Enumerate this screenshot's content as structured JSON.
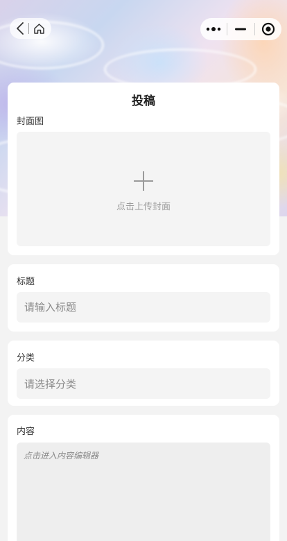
{
  "nav": {
    "back_icon": "chevron-left-icon",
    "home_icon": "home-icon",
    "more_icon": "more-dots-icon",
    "minimize_icon": "minimize-icon",
    "close_icon": "target-circle-icon"
  },
  "page": {
    "title": "投稿"
  },
  "cover": {
    "label": "封面图",
    "upload_text": "点击上传封面",
    "upload_icon": "plus-icon"
  },
  "title_field": {
    "label": "标题",
    "placeholder": "请输入标题"
  },
  "category_field": {
    "label": "分类",
    "placeholder": "请选择分类"
  },
  "content_field": {
    "label": "内容",
    "placeholder": "点击进入内容编辑器"
  },
  "colors": {
    "background": "#f3f3f3",
    "card": "#ffffff",
    "input_bg": "#f4f4f4",
    "placeholder_text": "#8a8a8a"
  }
}
